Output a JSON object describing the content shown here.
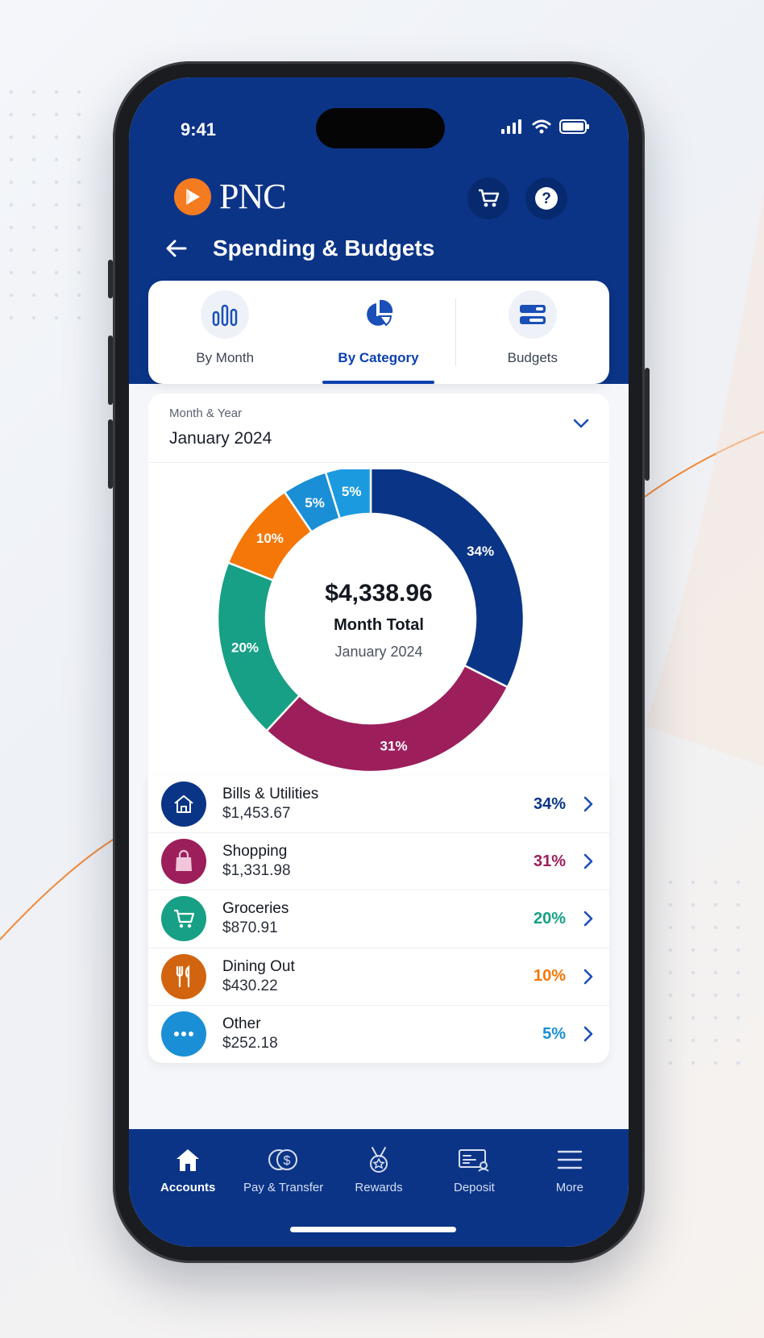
{
  "colors": {
    "navy": "#0b3487",
    "accent": "#0b3fb0",
    "bills": "#0a3586",
    "shopping": "#9c1f5c",
    "groceries": "#17a085",
    "dining": "#f47708",
    "other": "#1a8fd6",
    "other_light": "#1b9ae0",
    "brand_orange": "#f47b20"
  },
  "status_bar": {
    "time": "9:41"
  },
  "header": {
    "brand": "PNC",
    "cart_icon": "cart-icon",
    "help_icon": "help-icon",
    "title": "Spending & Budgets"
  },
  "tabs": [
    {
      "label": "By Month",
      "icon": "bar-chart-icon"
    },
    {
      "label": "By Category",
      "icon": "pie-chart-icon",
      "active": true
    },
    {
      "label": "Budgets",
      "icon": "budget-bars-icon"
    }
  ],
  "month_selector": {
    "label": "Month & Year",
    "value": "January 2024"
  },
  "summary": {
    "total": "$4,338.96",
    "label": "Month Total",
    "period": "January 2024"
  },
  "chart_data": {
    "type": "pie",
    "categories": [
      "Bills & Utilities",
      "Shopping",
      "Groceries",
      "Dining Out",
      "Other",
      "Other"
    ],
    "values": [
      34,
      31,
      20,
      10,
      5,
      5
    ],
    "labels": [
      "34%",
      "31%",
      "20%",
      "10%",
      "5%",
      "5%"
    ],
    "colors": [
      "#0a3586",
      "#9c1f5c",
      "#17a085",
      "#f47708",
      "#1a8fd6",
      "#1b9ae0"
    ]
  },
  "categories": [
    {
      "name": "Bills & Utilities",
      "amount": "$1,453.67",
      "percent": "34%",
      "icon": "home-icon",
      "color": "#0a3586"
    },
    {
      "name": "Shopping",
      "amount": "$1,331.98",
      "percent": "31%",
      "icon": "shopping-bag-icon",
      "color": "#9c1f5c"
    },
    {
      "name": "Groceries",
      "amount": "$870.91",
      "percent": "20%",
      "icon": "cart-icon",
      "color": "#17a085"
    },
    {
      "name": "Dining Out",
      "amount": "$430.22",
      "percent": "10%",
      "icon": "utensils-icon",
      "color": "#e8720e"
    },
    {
      "name": "Other",
      "amount": "$252.18",
      "percent": "5%",
      "icon": "more-dots-icon",
      "color": "#1a8fd6"
    }
  ],
  "bottom_nav": [
    {
      "label": "Accounts",
      "icon": "home-icon",
      "active": true
    },
    {
      "label": "Pay & Transfer",
      "icon": "dollar-transfer-icon"
    },
    {
      "label": "Rewards",
      "icon": "medal-icon"
    },
    {
      "label": "Deposit",
      "icon": "check-deposit-icon"
    },
    {
      "label": "More",
      "icon": "menu-icon"
    }
  ]
}
